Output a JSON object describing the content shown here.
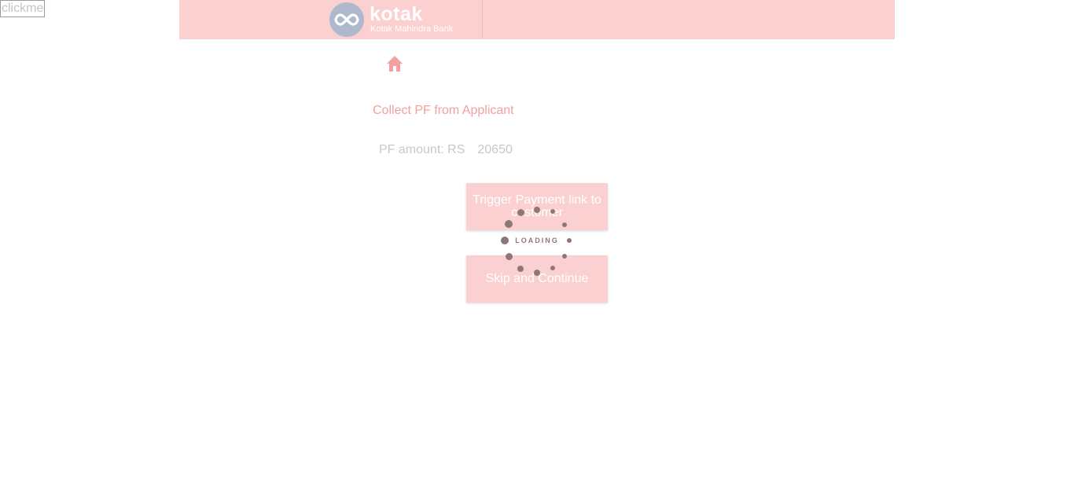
{
  "debug": {
    "clickme_label": "clickme"
  },
  "header": {
    "logo_name": "kotak",
    "logo_sub": "Kotak Mahindra Bank",
    "background": "#fbd0d0"
  },
  "nav": {
    "home_icon": "home-icon"
  },
  "main": {
    "title": "Collect PF from Applicant",
    "pf_label": "PF amount: RS",
    "pf_amount": "20650",
    "trigger_button": "Trigger Payment link to customer",
    "skip_button": "Skip and Continue"
  },
  "loader": {
    "text": "LOADING",
    "color": "#8f7777"
  },
  "colors": {
    "accent": "#f4a0a0",
    "button_bg": "#fbd0d0"
  }
}
